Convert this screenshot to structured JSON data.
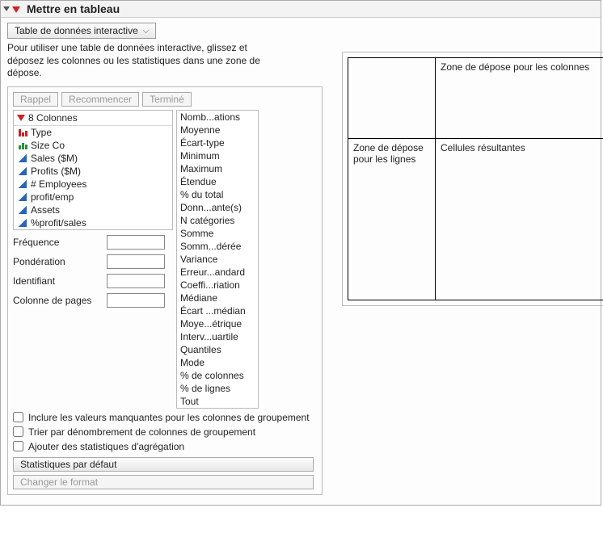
{
  "title": "Mettre en tableau",
  "table_mode": "Table de données interactive",
  "instruction": "Pour utiliser une table de données interactive, glissez et déposez les colonnes ou les statistiques dans une zone de dépose.",
  "buttons": {
    "recall": "Rappel",
    "redo": "Recommencer",
    "done": "Terminé"
  },
  "columns_header": "8 Colonnes",
  "columns": [
    {
      "name": "Type",
      "icon": "red-bars"
    },
    {
      "name": "Size Co",
      "icon": "green-bars"
    },
    {
      "name": "Sales ($M)",
      "icon": "blue-tri"
    },
    {
      "name": "Profits ($M)",
      "icon": "blue-tri"
    },
    {
      "name": "# Employees",
      "icon": "blue-tri"
    },
    {
      "name": "profit/emp",
      "icon": "blue-tri"
    },
    {
      "name": "Assets",
      "icon": "blue-tri"
    },
    {
      "name": "%profit/sales",
      "icon": "blue-tri"
    }
  ],
  "params": {
    "frequency_label": "Fréquence",
    "weight_label": "Pondération",
    "ident_label": "Identifiant",
    "page_col_label": "Colonne de pages",
    "frequency": "",
    "weight": "",
    "ident": "",
    "page_col": ""
  },
  "statistics": [
    "Nomb...ations",
    "Moyenne",
    "Écart-type",
    "Minimum",
    "Maximum",
    "Étendue",
    "% du total",
    "Donn...ante(s)",
    "N catégories",
    "Somme",
    "Somm...dérée",
    "Variance",
    "Erreur...andard",
    "Coeffi...riation",
    "Médiane",
    "Écart ...médian",
    "Moye...étrique",
    "Interv...uartile",
    "Quantiles",
    "Mode",
    "% de colonnes",
    "% de lignes",
    "Tout"
  ],
  "checkboxes": {
    "include_missing": "Inclure les valeurs manquantes pour les colonnes de groupement",
    "sort_by_count": "Trier par dénombrement de colonnes de groupement",
    "add_agg_stats": "Ajouter des statistiques d'agrégation"
  },
  "default_stats_btn": "Statistiques par défaut",
  "change_format_btn": "Changer le format",
  "drop_zones": {
    "top_left": "",
    "top_right": "Zone de dépose pour les colonnes",
    "bottom_left": "Zone de dépose pour les lignes",
    "bottom_right": "Cellules résultantes"
  }
}
